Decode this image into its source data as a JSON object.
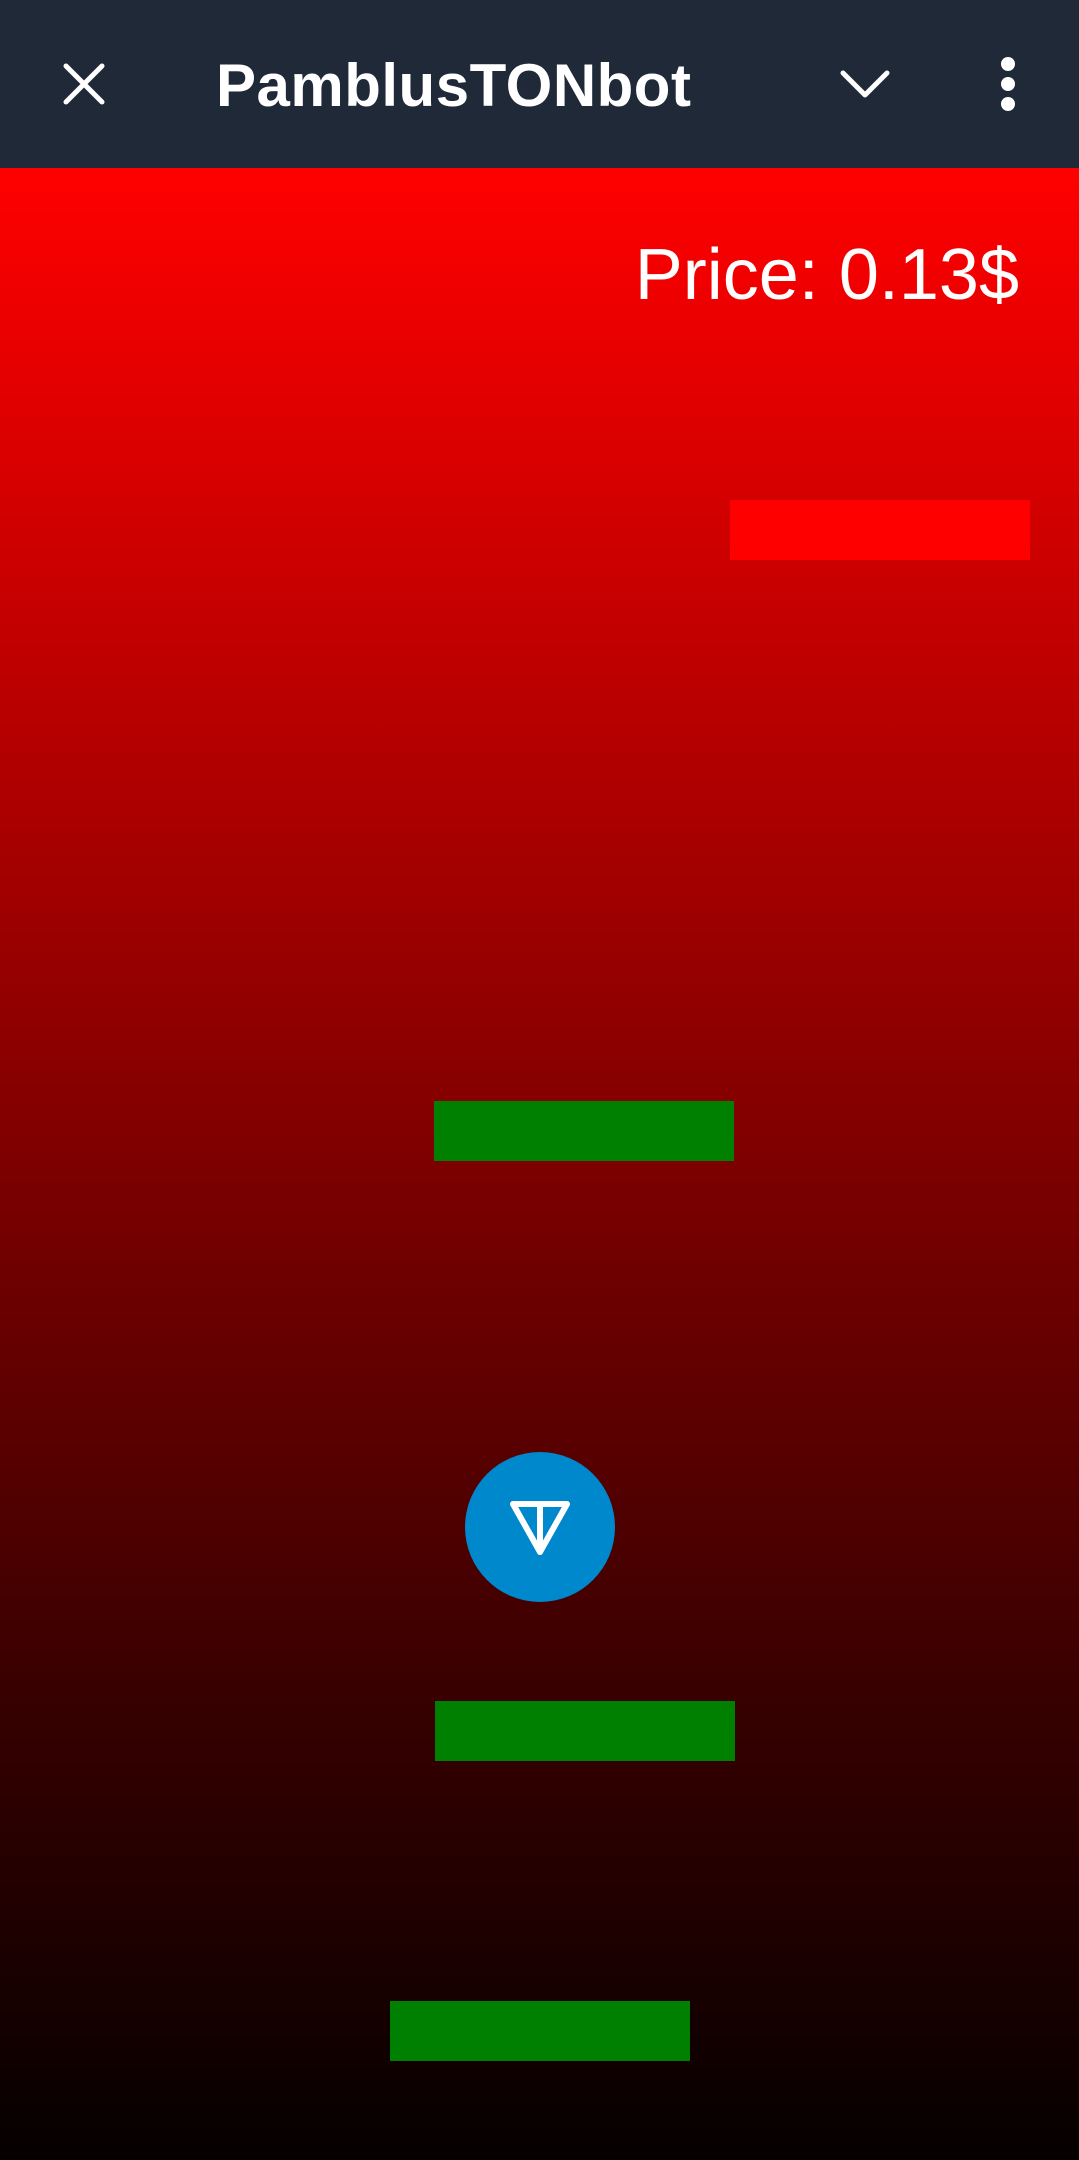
{
  "header": {
    "title": "PamblusTONbot",
    "close_icon": "close-icon",
    "collapse_icon": "chevron-down-icon",
    "menu_icon": "more-vertical-icon",
    "background_color": "#1f2937"
  },
  "game": {
    "price_label": "Price:",
    "price_value": "0.13$",
    "gradient_top_color": "#ff0000",
    "gradient_bottom_color": "#050000",
    "player": {
      "icon": "ton-logo-icon",
      "color": "#0088cc"
    },
    "platforms": [
      {
        "color": "red"
      },
      {
        "color": "green"
      },
      {
        "color": "green"
      },
      {
        "color": "green"
      }
    ]
  }
}
